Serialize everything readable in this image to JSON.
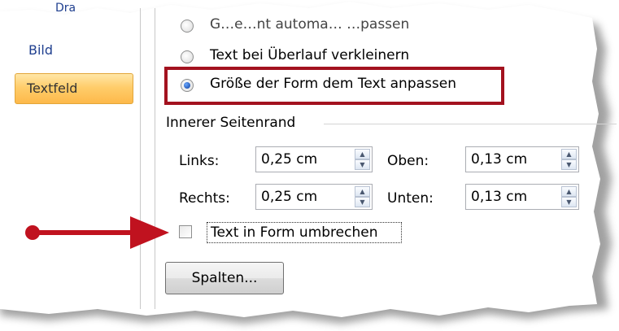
{
  "sidebar": {
    "top_item_partial": "Dra",
    "items": [
      {
        "label": "Bild"
      },
      {
        "label": "Textfeld",
        "selected": true
      }
    ]
  },
  "autofit": {
    "options": [
      {
        "label": "G…e…nt automa… …passen",
        "checked": false
      },
      {
        "label": "Text bei Überlauf verkleinern",
        "checked": false
      },
      {
        "label": "Größe der Form dem Text anpassen",
        "checked": true
      }
    ]
  },
  "inner_margin": {
    "title": "Innerer Seitenrand",
    "left": {
      "label": "Links:",
      "value": "0,25 cm"
    },
    "top": {
      "label": "Oben:",
      "value": "0,13 cm"
    },
    "right": {
      "label": "Rechts:",
      "value": "0,25 cm"
    },
    "bottom": {
      "label": "Unten:",
      "value": "0,13 cm"
    }
  },
  "wrap_checkbox": {
    "label": "Text in Form umbrechen",
    "checked": false
  },
  "columns_button": {
    "label": "Spalten..."
  },
  "colors": {
    "highlight": "#a3121f",
    "arrow": "#c0121f",
    "selected_item": "#ffcd6b"
  }
}
